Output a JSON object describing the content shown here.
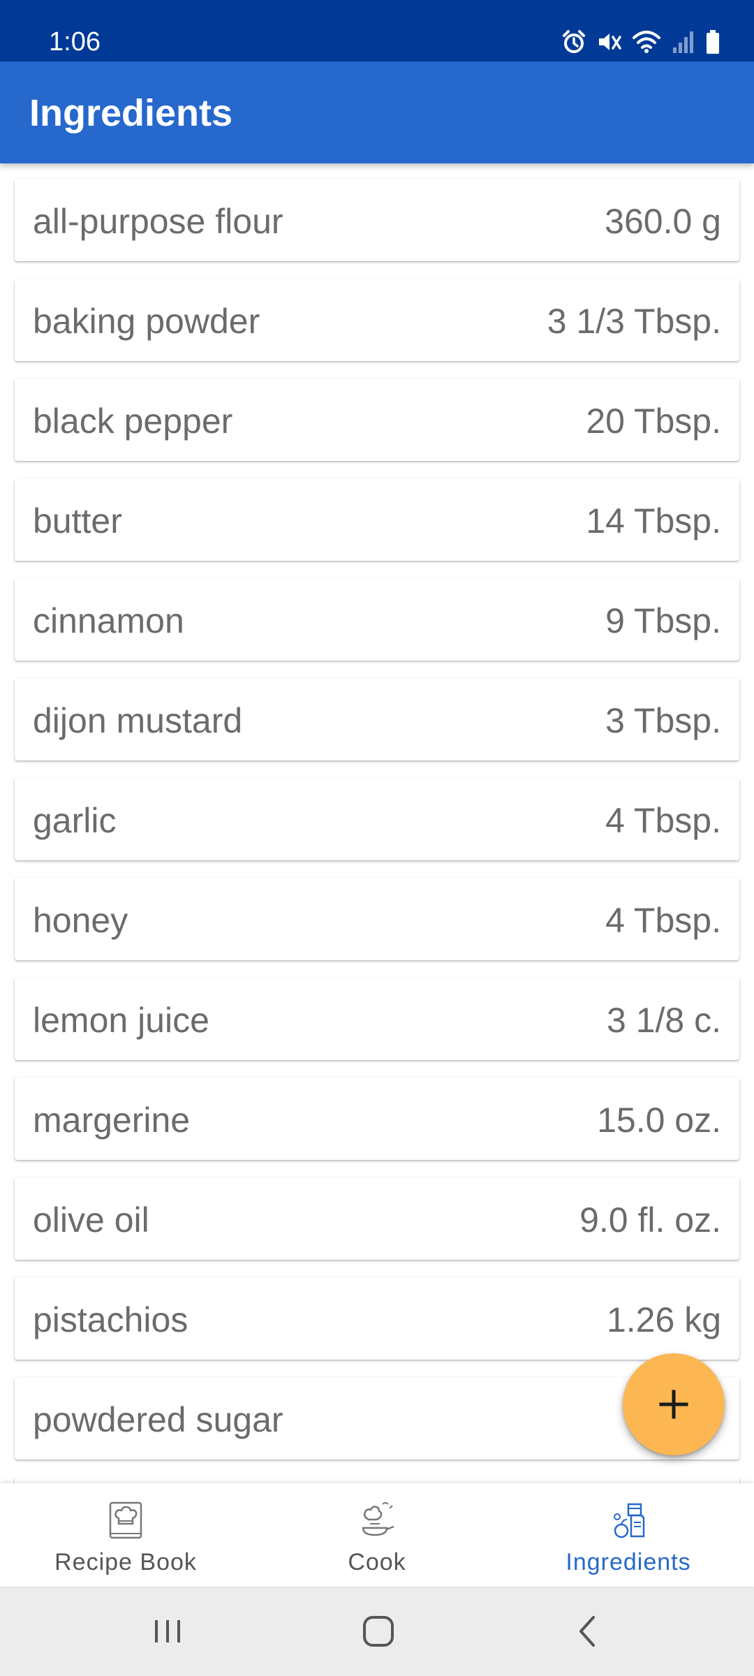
{
  "status_bar": {
    "time": "1:06",
    "icons": [
      "alarm-icon",
      "mute-icon",
      "wifi-icon",
      "signal-icon",
      "battery-icon"
    ]
  },
  "app_bar": {
    "title": "Ingredients"
  },
  "ingredients": [
    {
      "name": "all-purpose flour",
      "quantity": "360.0 g"
    },
    {
      "name": "baking powder",
      "quantity": "3 1/3 Tbsp."
    },
    {
      "name": "black pepper",
      "quantity": "20 Tbsp."
    },
    {
      "name": "butter",
      "quantity": "14 Tbsp."
    },
    {
      "name": "cinnamon",
      "quantity": "9 Tbsp."
    },
    {
      "name": "dijon mustard",
      "quantity": "3 Tbsp."
    },
    {
      "name": "garlic",
      "quantity": "4 Tbsp."
    },
    {
      "name": "honey",
      "quantity": "4 Tbsp."
    },
    {
      "name": "lemon juice",
      "quantity": "3 1/8 c."
    },
    {
      "name": "margerine",
      "quantity": "15.0 oz."
    },
    {
      "name": "olive oil",
      "quantity": "9.0 fl. oz."
    },
    {
      "name": "pistachios",
      "quantity": "1.26 kg"
    },
    {
      "name": "powdered sugar",
      "quantity": ""
    }
  ],
  "fab": {
    "icon": "plus-icon"
  },
  "bottom_nav": {
    "items": [
      {
        "label": "Recipe Book",
        "icon": "recipe-book-icon",
        "active": false
      },
      {
        "label": "Cook",
        "icon": "cook-icon",
        "active": false
      },
      {
        "label": "Ingredients",
        "icon": "ingredients-icon",
        "active": true
      }
    ]
  },
  "system_nav": {
    "buttons": [
      "recent-apps-icon",
      "home-icon",
      "back-icon"
    ]
  },
  "colors": {
    "status_bar": "#003a96",
    "app_bar": "#2668cc",
    "fab": "#fdb752",
    "active_nav": "#2668cc",
    "text_secondary": "#6b6b6b"
  }
}
